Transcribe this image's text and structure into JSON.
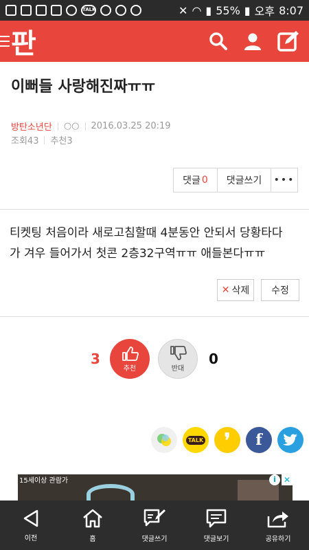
{
  "status_bar": {
    "battery": "55%",
    "ampm": "오후",
    "time": "8:07"
  },
  "header": {
    "logo": "판",
    "brand_color": "#e8453c"
  },
  "post": {
    "title": "이뻐들 사랑해진짜ㅠㅠ",
    "author": "방탄소년단",
    "badge": "○○",
    "datetime": "2016.03.25 20:19",
    "views_label": "조회",
    "views": "43",
    "recommend_label": "추천",
    "recommend": "3",
    "body_line1": "티켓팅 처음이라 새로고침할때 4분동안 안되서 당황타다",
    "body_line2": "가 겨우 들어가서 첫콘 2층32구역ㅠㅠ 애들본다ㅠㅠ"
  },
  "actions": {
    "comment_label": "댓글",
    "comment_count": "0",
    "write_comment": "댓글쓰기",
    "more": "•••",
    "delete": "삭제",
    "edit": "수정"
  },
  "vote": {
    "up_count": "3",
    "up_label": "추천",
    "down_label": "반대",
    "down_count": "0"
  },
  "share": {
    "kakaotalk_label": "TALK"
  },
  "ad": {
    "rating": "15세이상 관람가"
  },
  "bottom_nav": {
    "back": "이전",
    "home": "홈",
    "write_comment": "댓글쓰기",
    "view_comments": "댓글보기",
    "share": "공유하기"
  }
}
